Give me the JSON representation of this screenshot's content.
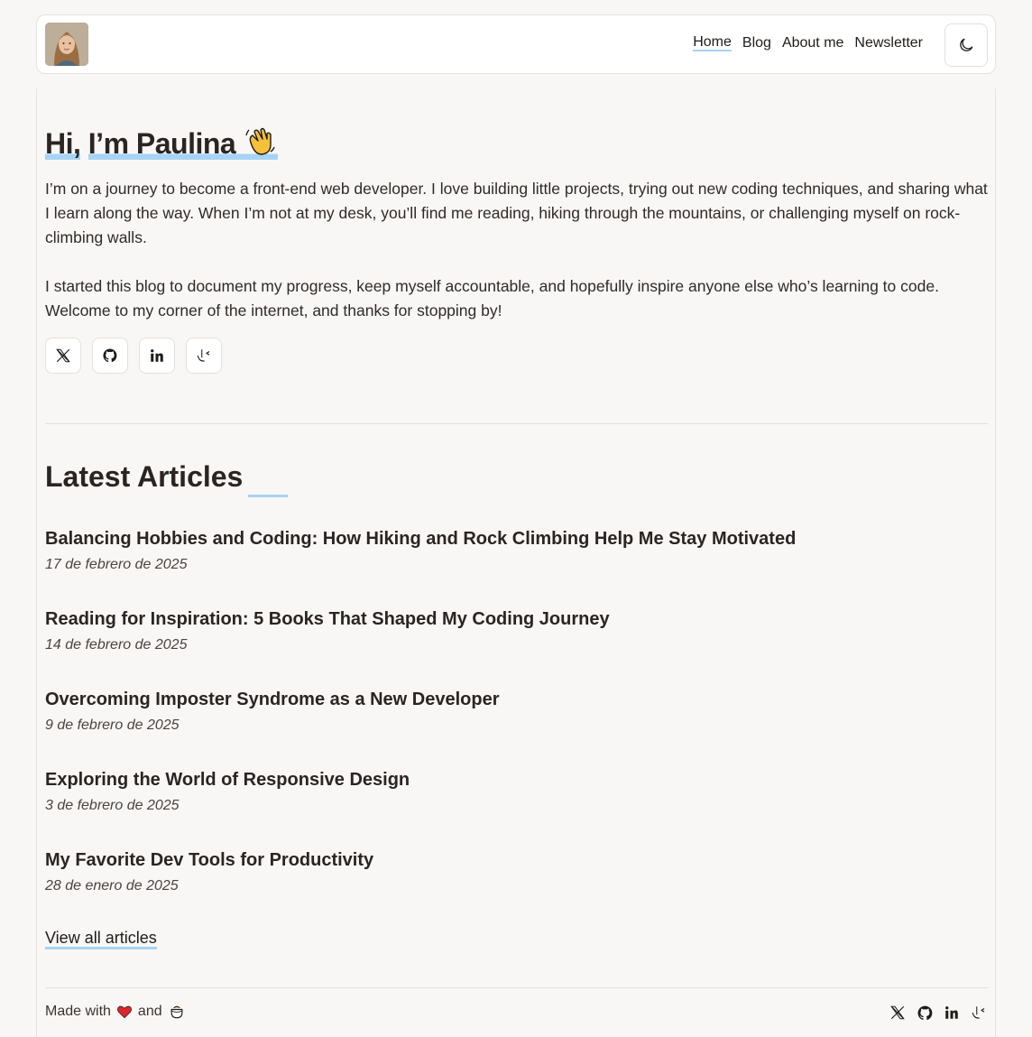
{
  "header": {
    "nav": [
      {
        "label": "Home",
        "active": true
      },
      {
        "label": "Blog",
        "active": false
      },
      {
        "label": "About me",
        "active": false
      },
      {
        "label": "Newsletter",
        "active": false
      }
    ],
    "theme_icon": "moon-icon"
  },
  "hero": {
    "greeting": "Hi,",
    "name": "I’m Paulina",
    "emoji": "waving-hand-icon",
    "paragraphs": [
      "I’m on a journey to become a front-end web developer. I love building little projects, trying out new coding techniques, and sharing what I learn along the way. When I’m not at my desk, you’ll find me reading, hiking through the mountains, or challenging myself on rock-climbing walls.",
      "I started this blog to document my progress, keep myself accountable, and hopefully inspire anyone else who’s learning to code. Welcome to my corner of the internet, and thanks for stopping by!"
    ],
    "socials": [
      "x-icon",
      "github-icon",
      "linkedin-icon",
      "frontend-mentor-icon"
    ]
  },
  "latest": {
    "title": "Latest Articles",
    "articles": [
      {
        "title": "Balancing Hobbies and Coding: How Hiking and Rock Climbing Help Me Stay Motivated",
        "date": "17 de febrero de 2025"
      },
      {
        "title": "Reading for Inspiration: 5 Books That Shaped My Coding Journey",
        "date": "14 de febrero de 2025"
      },
      {
        "title": "Overcoming Imposter Syndrome as a New Developer",
        "date": "9 de febrero de 2025"
      },
      {
        "title": "Exploring the World of Responsive Design",
        "date": "3 de febrero de 2025"
      },
      {
        "title": "My Favorite Dev Tools for Productivity",
        "date": "28 de enero de 2025"
      }
    ],
    "view_all": "View all articles"
  },
  "footer": {
    "made_with": "Made with",
    "and": "and",
    "accent_color": "#a7d3f5"
  }
}
